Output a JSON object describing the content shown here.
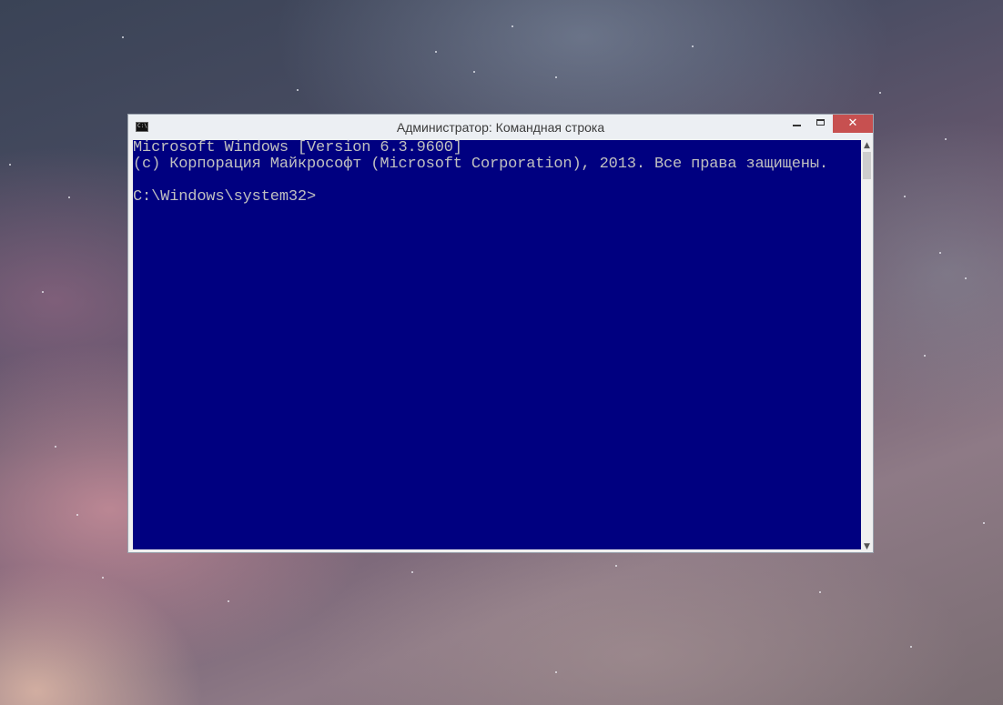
{
  "window": {
    "title": "Администратор: Командная строка",
    "icon": "cmd-icon",
    "controls": {
      "minimize": "minimize-icon",
      "maximize": "maximize-icon",
      "close_label": "✕"
    }
  },
  "console": {
    "lines": [
      "Microsoft Windows [Version 6.3.9600]",
      "(c) Корпорация Майкрософт (Microsoft Corporation), 2013. Все права защищены.",
      "",
      "C:\\Windows\\system32>"
    ],
    "background": "#000080",
    "foreground": "#c0c0c0"
  },
  "scrollbar": {
    "up": "▲",
    "down": "▼"
  },
  "colors": {
    "close_button": "#c75050",
    "titlebar": "#eceff3"
  }
}
